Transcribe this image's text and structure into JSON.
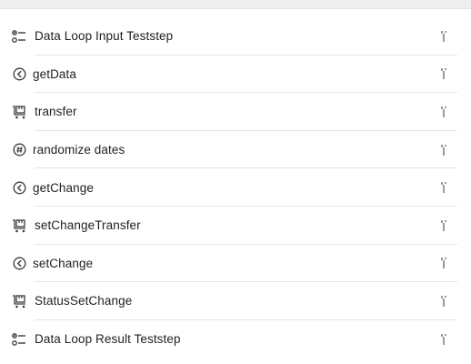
{
  "steps": [
    {
      "label": "Data Loop Input Teststep",
      "icon": "data-loop-icon"
    },
    {
      "label": "getData",
      "icon": "circle-arrow-left-icon"
    },
    {
      "label": "transfer",
      "icon": "transfer-cart-icon"
    },
    {
      "label": "randomize dates",
      "icon": "hash-circle-icon"
    },
    {
      "label": "getChange",
      "icon": "circle-arrow-left-icon"
    },
    {
      "label": "setChangeTransfer",
      "icon": "transfer-cart-icon"
    },
    {
      "label": "setChange",
      "icon": "circle-arrow-left-icon"
    },
    {
      "label": "StatusSetChange",
      "icon": "transfer-cart-icon"
    },
    {
      "label": "Data Loop Result Teststep",
      "icon": "data-loop-icon"
    }
  ],
  "colors": {
    "text": "#1f1f21",
    "icon": "#3a3a3c",
    "handle": "#9a9a9e",
    "separator": "#e5e5e5"
  }
}
